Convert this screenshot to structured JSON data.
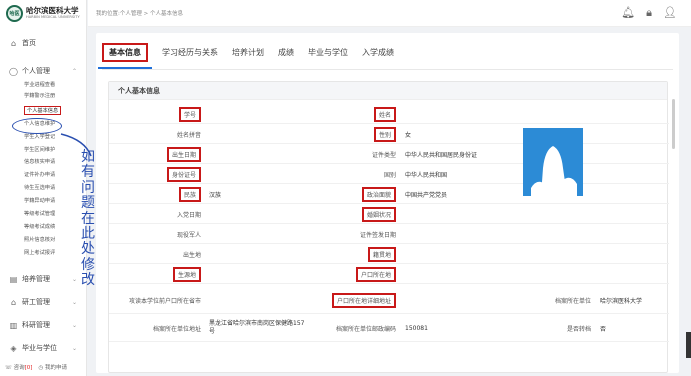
{
  "logo": {
    "badge": "哈医",
    "name_cn": "哈尔滨医科大学",
    "name_en": "HARBIN MEDICAL UNIVERSITY"
  },
  "breadcrumb": "我的位置:个人管理 > 个人基本信息",
  "sidebar": {
    "home": "首页",
    "personal": "个人管理",
    "sub_items": [
      "学业进程查看",
      "学籍警示注册",
      "个人基本信息",
      "个人信息维护",
      "学生入学登记",
      "学生区间维护",
      "信息核实申请",
      "证件补办申请",
      "待生互选申请",
      "学籍异动申请",
      "等级考试管理",
      "等级考试成绩",
      "照片信息核对",
      "网上考试报评"
    ],
    "active_index": 2,
    "training": "培养管理",
    "research_mgmt": "研工管理",
    "sci_mgmt": "科研管理",
    "degree": "毕业与学位",
    "bottom": {
      "consult": "咨询",
      "count": "[0]",
      "apply": "我的申请"
    }
  },
  "tabs": [
    "基本信息",
    "学习经历与关系",
    "培养计划",
    "成绩",
    "毕业与学位",
    "入学成绩"
  ],
  "panel_title": "个人基本信息",
  "fields": {
    "student_id": "学号",
    "name": "姓名",
    "name_pinyin": "姓名拼音",
    "gender": "性别",
    "gender_val": "女",
    "birth_date": "出生日期",
    "id_type": "证件类型",
    "id_type_val": "中华人民共和国居民身份证",
    "id_number": "身份证号",
    "nationality": "国别",
    "nationality_val": "中华人民共和国",
    "ethnicity": "民族",
    "ethnicity_val": "汉族",
    "political": "政治面貌",
    "political_val": "中国共产党党员",
    "party_date": "入党日期",
    "marital": "婚姻状况",
    "soldier": "现役军人",
    "id_issue_date": "证件签发日期",
    "birthplace": "出生地",
    "native_place": "籍贯地",
    "origin": "生源地",
    "hukou": "户口所在地",
    "hukou_province": "攻读本学位前户口所在省市",
    "hukou_address": "户口所在地详细地址",
    "archive_unit": "档案所在单位",
    "archive_unit_val": "哈尔滨医科大学",
    "archive_address": "档案所在单位地址",
    "archive_address_val": "黑龙江省哈尔滨市南岗区保健路157号",
    "archive_zip": "档案所在单位邮政编码",
    "archive_zip_val": "150081",
    "transfer": "是否转档",
    "transfer_val": "否"
  },
  "annotation": "如有问题在此处修改"
}
